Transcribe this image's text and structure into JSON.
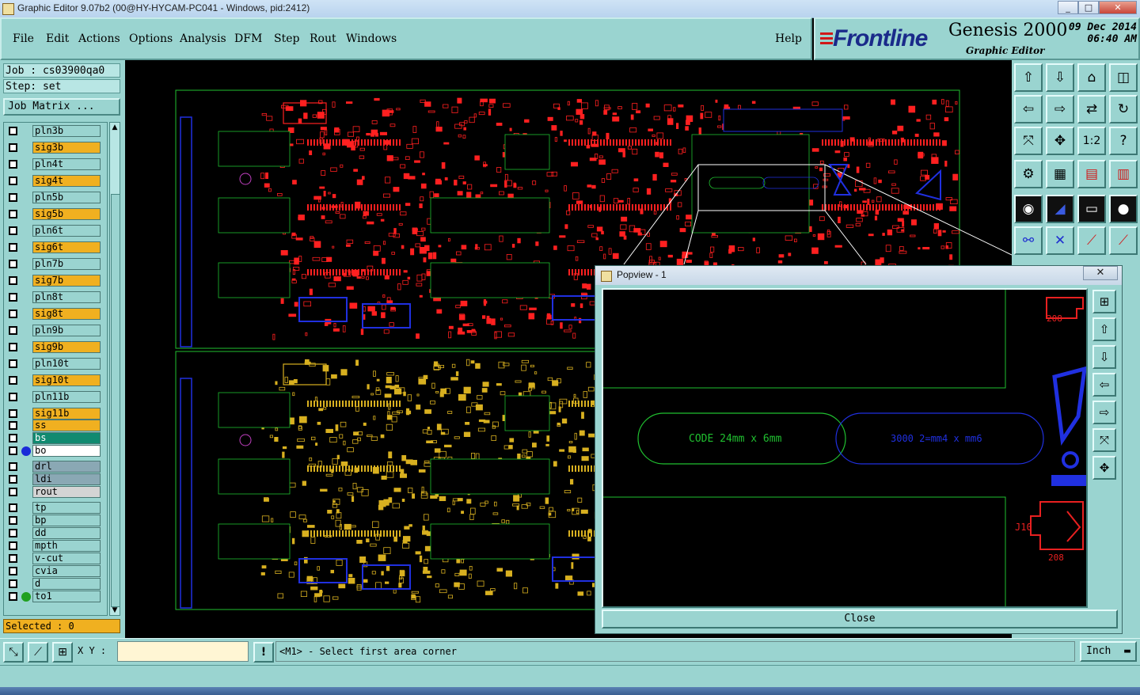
{
  "window": {
    "title": "Graphic Editor 9.07b2 (00@HY-HYCAM-PC041 - Windows, pid:2412)",
    "minimize": "_",
    "maximize": "□",
    "close": "✕"
  },
  "menu": {
    "items": [
      "File",
      "Edit",
      "Actions",
      "Options",
      "Analysis",
      "DFM",
      "Step",
      "Rout",
      "Windows"
    ],
    "help": "Help"
  },
  "logo": {
    "brand": "Frontline",
    "product": "Genesis 2000",
    "subtitle": "Graphic Editor",
    "date": "09 Dec 2014",
    "time": "06:40 AM"
  },
  "job": {
    "job": "Job : cs03900qa0",
    "step": "Step: set",
    "matrix": "Job Matrix ..."
  },
  "layers": [
    {
      "name": "pln3b",
      "color": "#9ad4d0"
    },
    {
      "name": "sig3b",
      "color": "#f0b020"
    },
    {
      "name": "pln4t",
      "color": "#9ad4d0"
    },
    {
      "name": "sig4t",
      "color": "#f0b020"
    },
    {
      "name": "pln5b",
      "color": "#9ad4d0"
    },
    {
      "name": "sig5b",
      "color": "#f0b020"
    },
    {
      "name": "pln6t",
      "color": "#9ad4d0"
    },
    {
      "name": "sig6t",
      "color": "#f0b020"
    },
    {
      "name": "pln7b",
      "color": "#9ad4d0"
    },
    {
      "name": "sig7b",
      "color": "#f0b020"
    },
    {
      "name": "pln8t",
      "color": "#9ad4d0"
    },
    {
      "name": "sig8t",
      "color": "#f0b020"
    },
    {
      "name": "pln9b",
      "color": "#9ad4d0"
    },
    {
      "name": "sig9b",
      "color": "#f0b020"
    },
    {
      "name": "pln10t",
      "color": "#9ad4d0"
    },
    {
      "name": "sig10t",
      "color": "#f0b020"
    },
    {
      "name": "pln11b",
      "color": "#9ad4d0"
    },
    {
      "name": "sig11b",
      "color": "#f0b020"
    },
    {
      "name": "ss",
      "color": "#f0b020"
    },
    {
      "name": "bs",
      "color": "#108a70"
    },
    {
      "name": "bo",
      "color": "#ffffff",
      "dot": "#1a2ad8"
    },
    {
      "name": "drl",
      "color": "#8aa8b4"
    },
    {
      "name": "ldi",
      "color": "#8aa8b4"
    },
    {
      "name": "rout",
      "color": "#d4d4d4"
    },
    {
      "name": "tp",
      "color": "#9ad4d0"
    },
    {
      "name": "bp",
      "color": "#9ad4d0"
    },
    {
      "name": "dd",
      "color": "#9ad4d0"
    },
    {
      "name": "mpth",
      "color": "#9ad4d0"
    },
    {
      "name": "v-cut",
      "color": "#9ad4d0"
    },
    {
      "name": "cvia",
      "color": "#9ad4d0"
    },
    {
      "name": "d",
      "color": "#9ad4d0"
    },
    {
      "name": "to1",
      "color": "#9ad4d0",
      "dot": "#20a020"
    }
  ],
  "selected": "Selected : 0",
  "popview": {
    "title": "Popview - 1",
    "close_label": "Close",
    "text_code": "CODE 24mm x 6mm",
    "text_mirror": "3000 2=mm4 x mm6",
    "label_j10": "J10",
    "label_208": "208"
  },
  "bottom": {
    "xy_label": "X Y :",
    "xy_value": "",
    "alert": "!",
    "message": "<M1> - Select first area corner",
    "unit": "Inch"
  },
  "colors": {
    "panel": "#9ad4d0",
    "red_layer": "#ff2020",
    "yellow_layer": "#d8b020",
    "blue_layer": "#2030e0",
    "outline": "#20c030"
  }
}
